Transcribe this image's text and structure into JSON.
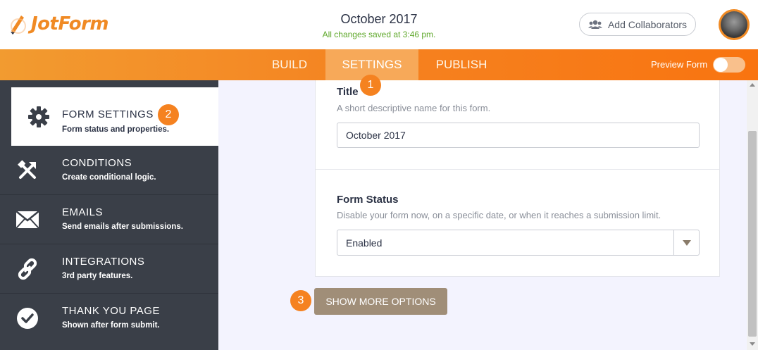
{
  "app": {
    "brand": "JotForm"
  },
  "header": {
    "title": "October 2017",
    "save_status": "All changes saved at 3:46 pm.",
    "collaborators_label": "Add Collaborators"
  },
  "nav": {
    "tabs": [
      {
        "label": "BUILD"
      },
      {
        "label": "SETTINGS",
        "active": true
      },
      {
        "label": "PUBLISH"
      }
    ],
    "preview_label": "Preview Form",
    "preview_enabled": false
  },
  "sidebar": {
    "items": [
      {
        "title": "FORM SETTINGS",
        "subtitle": "Form status and properties.",
        "icon": "gear-icon",
        "active": true
      },
      {
        "title": "CONDITIONS",
        "subtitle": "Create conditional logic.",
        "icon": "conditions-icon"
      },
      {
        "title": "EMAILS",
        "subtitle": "Send emails after submissions.",
        "icon": "envelope-icon"
      },
      {
        "title": "INTEGRATIONS",
        "subtitle": "3rd party features.",
        "icon": "link-icon"
      },
      {
        "title": "THANK YOU PAGE",
        "subtitle": "Shown after form submit.",
        "icon": "check-circle-icon"
      }
    ]
  },
  "form": {
    "title_label": "Title",
    "title_desc": "A short descriptive name for this form.",
    "title_value": "October 2017",
    "status_label": "Form Status",
    "status_desc": "Disable your form now, on a specific date, or when it reaches a submission limit.",
    "status_value": "Enabled",
    "more_button": "SHOW MORE OPTIONS"
  },
  "badges": {
    "one": "1",
    "two": "2",
    "three": "3"
  },
  "colors": {
    "accent": "#f58220",
    "sidebar_bg": "#3a3f48",
    "button": "#a08e78",
    "success_text": "#5fa82b"
  }
}
